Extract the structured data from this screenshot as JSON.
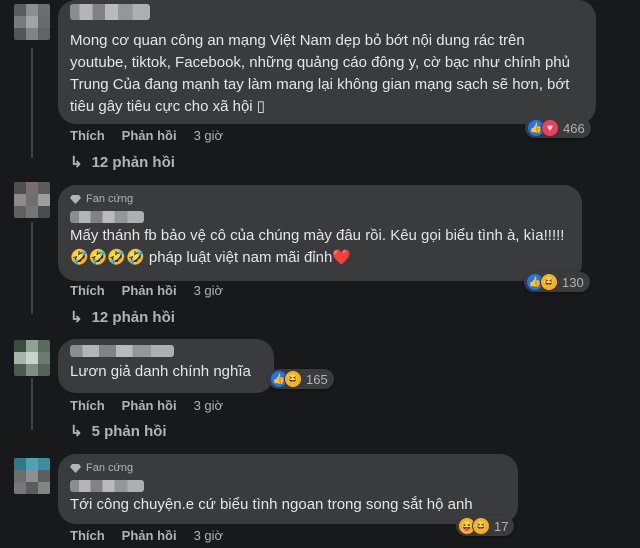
{
  "comments": [
    {
      "badge": "",
      "text": "Mong cơ quan công an mạng Việt Nam dẹp bỏ bớt nội dung rác trên youtube, tiktok, Facebook, những quảng cáo đông y, cờ bạc như chính phủ Trung Của đang mạnh tay làm mang lại không gian mạng sạch sẽ hơn, bớt tiêu gây tiêu cực cho xã hội ▯",
      "reactions": [
        "like",
        "love"
      ],
      "reaction_count": "466",
      "like_label": "Thích",
      "reply_label": "Phản hồi",
      "time": "3 giờ",
      "replies_label": "12 phản hồi"
    },
    {
      "badge": "Fan cứng",
      "text": "Mấy thánh fb bảo vệ cô của chúng mày đâu rồi. Kêu gọi biểu tình à, kìa!!!!!🤣🤣🤣🤣 pháp luật việt nam mãi đỉnh❤️",
      "reactions": [
        "like",
        "haha"
      ],
      "reaction_count": "130",
      "like_label": "Thích",
      "reply_label": "Phản hồi",
      "time": "3 giờ",
      "replies_label": "12 phản hồi"
    },
    {
      "badge": "",
      "text": "Lươn giả danh chính nghĩa",
      "reactions": [
        "like",
        "haha"
      ],
      "reaction_count": "165",
      "like_label": "Thích",
      "reply_label": "Phản hồi",
      "time": "3 giờ",
      "replies_label": "5 phản hồi"
    },
    {
      "badge": "Fan cứng",
      "text": "Tới công chuyện.e cứ biểu tình ngoan trong song sắt hộ anh",
      "reactions": [
        "haha",
        "haha"
      ],
      "reaction_count": "17",
      "like_label": "Thích",
      "reply_label": "Phản hồi",
      "time": "3 giờ",
      "replies_label": ""
    }
  ],
  "colors": {
    "background": "#18191a",
    "bubble": "#3a3b3c",
    "text": "#e4e6eb",
    "secondary": "#b0b3b8",
    "like": "#1877f2",
    "love": "#f33e58",
    "haha": "#f7b125"
  },
  "icons": {
    "reply_arrow": "reply-arrow-icon",
    "badge": "diamond-icon"
  }
}
